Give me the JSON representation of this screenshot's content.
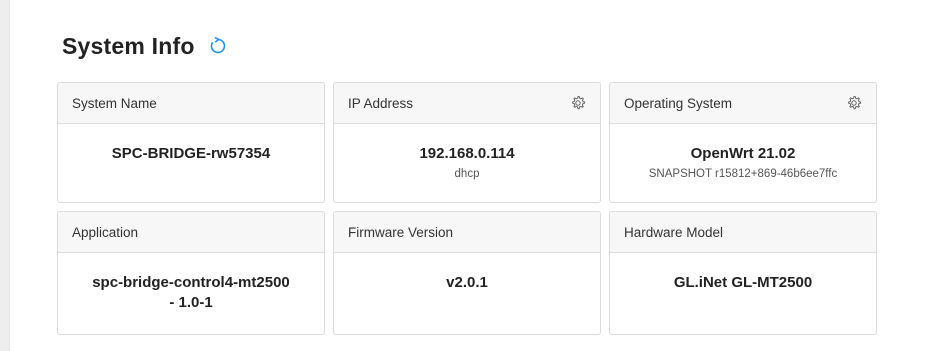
{
  "header": {
    "title": "System Info",
    "refresh_icon": "refresh-icon"
  },
  "colors": {
    "accent": "#1e90ff",
    "card_header_bg": "#f7f7f7",
    "border": "#dcdcdc"
  },
  "cards": [
    {
      "label": "System Name",
      "value": "SPC-BRIDGE-rw57354",
      "sub": "",
      "has_settings": false
    },
    {
      "label": "IP Address",
      "value": "192.168.0.114",
      "sub": "dhcp",
      "has_settings": true
    },
    {
      "label": "Operating System",
      "value": "OpenWrt 21.02",
      "sub": "SNAPSHOT r15812+869-46b6ee7ffc",
      "has_settings": true
    },
    {
      "label": "Application",
      "value": "spc-bridge-control4-mt2500",
      "value_line2": "- 1.0-1",
      "sub": "",
      "has_settings": false
    },
    {
      "label": "Firmware Version",
      "value": "v2.0.1",
      "sub": "",
      "has_settings": false
    },
    {
      "label": "Hardware Model",
      "value": "GL.iNet GL-MT2500",
      "sub": "",
      "has_settings": false
    }
  ]
}
